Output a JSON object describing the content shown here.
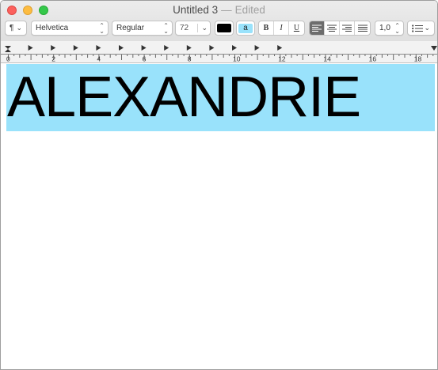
{
  "window": {
    "title": "Untitled 3",
    "separator": "—",
    "status": "Edited"
  },
  "toolbar": {
    "paragraph_styles_glyph": "¶",
    "font_family": "Helvetica",
    "font_style": "Regular",
    "font_size": "72",
    "text_color": "#000000",
    "highlight_label": "a",
    "highlight_color": "#99e2fb",
    "bold_label": "B",
    "italic_label": "I",
    "underline_label": "U",
    "alignment_active": "left",
    "line_spacing": "1,0",
    "list_icon": "list-bullets-icon"
  },
  "ruler": {
    "labels": [
      "0",
      "2",
      "4",
      "6",
      "8",
      "10",
      "12",
      "14",
      "16",
      "18"
    ]
  },
  "document": {
    "text": "ALEXANDRIE",
    "highlight_color": "#99e2fb"
  }
}
